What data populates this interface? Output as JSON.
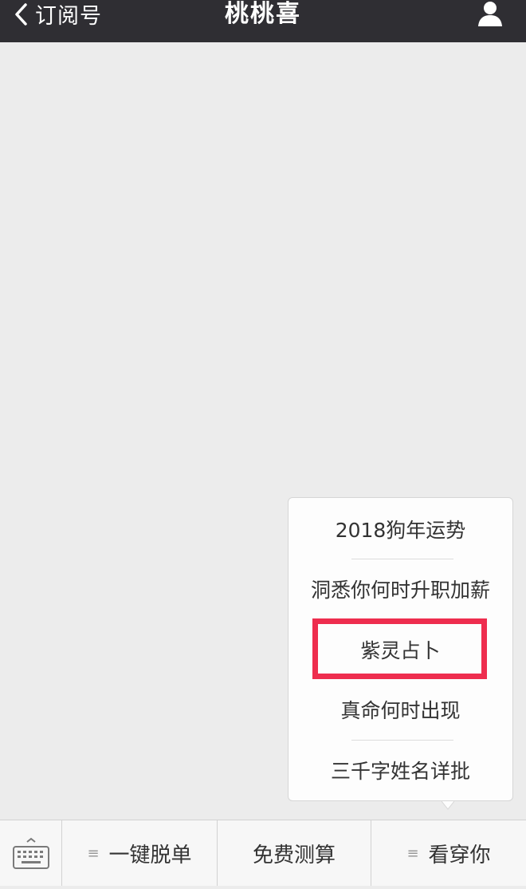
{
  "navbar": {
    "back_label": "订阅号",
    "title": "桃桃喜",
    "background": "#2f2e33"
  },
  "popup_menu": {
    "items": [
      {
        "label": "2018狗年运势"
      },
      {
        "label": "洞悉你何时升职加薪"
      },
      {
        "label": "紫灵占卜"
      },
      {
        "label": "真命何时出现"
      },
      {
        "label": "三千字姓名详批"
      }
    ],
    "highlighted_item": "紫灵占卜",
    "highlight_color": "#ee2d4e"
  },
  "bottom_menu": {
    "keyboard_icon": "keyboard-icon",
    "buttons": [
      {
        "label": "一键脱单",
        "submenu_icon": "≡"
      },
      {
        "label": "免费测算"
      },
      {
        "label": "看穿你",
        "submenu_icon": "≡"
      }
    ]
  }
}
